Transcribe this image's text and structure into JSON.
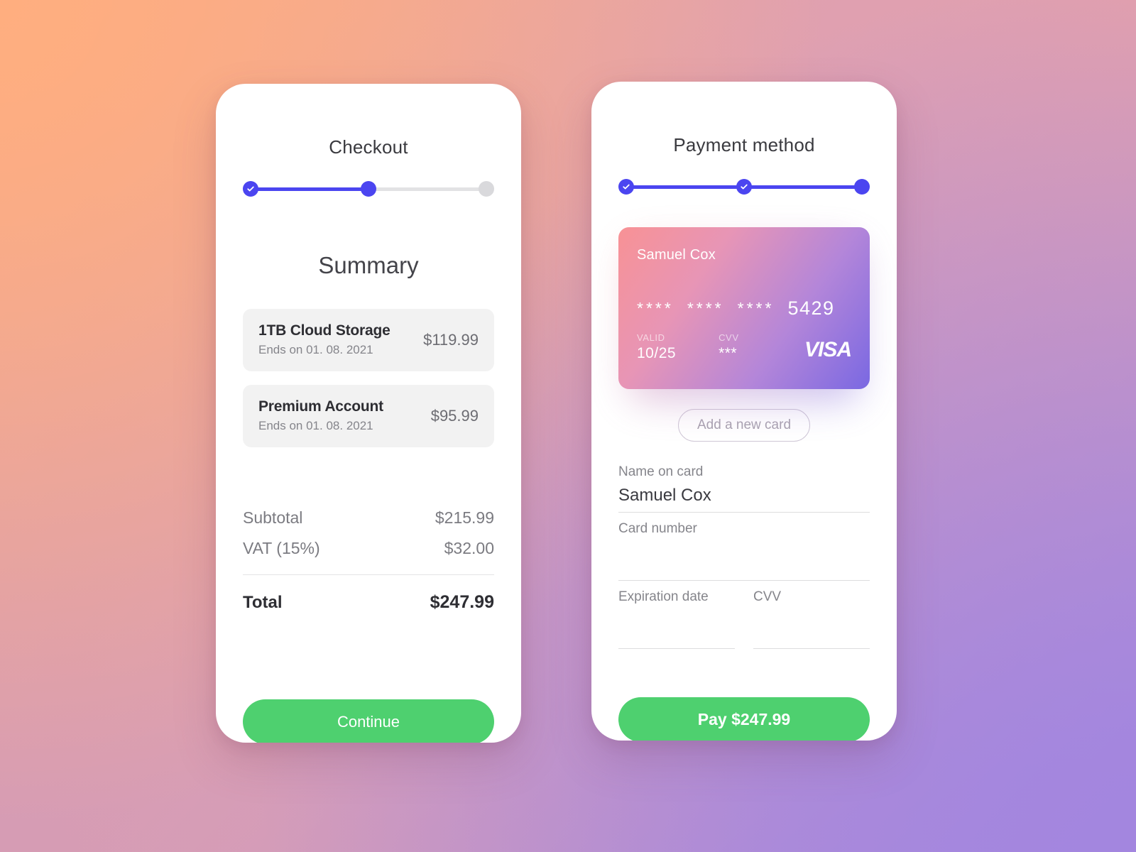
{
  "theme": {
    "accent_blue": "#4B45F0",
    "accent_green": "#4ED06F",
    "card_gradient_start": "#F89295",
    "card_gradient_end": "#7A68E2",
    "background_start": "#FFAE7F",
    "background_end": "#A386DF"
  },
  "checkout_screen": {
    "title": "Checkout",
    "stepper": {
      "steps": [
        {
          "state": "done",
          "icon": "check-icon"
        },
        {
          "state": "active",
          "icon": "dot"
        },
        {
          "state": "inactive",
          "icon": "dot"
        }
      ]
    },
    "summary_heading": "Summary",
    "items": [
      {
        "name": "1TB Cloud Storage",
        "subtitle": "Ends on 01. 08. 2021",
        "price": "$119.99"
      },
      {
        "name": "Premium Account",
        "subtitle": "Ends on 01. 08. 2021",
        "price": "$95.99"
      }
    ],
    "totals": [
      {
        "label": "Subtotal",
        "value": "$215.99"
      },
      {
        "label": "VAT (15%)",
        "value": "$32.00"
      }
    ],
    "total": {
      "label": "Total",
      "value": "$247.99"
    },
    "cta_label": "Continue"
  },
  "payment_screen": {
    "title": "Payment method",
    "stepper": {
      "steps": [
        {
          "state": "done",
          "icon": "check-icon"
        },
        {
          "state": "done",
          "icon": "check-icon"
        },
        {
          "state": "active",
          "icon": "dot"
        }
      ]
    },
    "credit_card": {
      "holder": "Samuel Cox",
      "number_groups": [
        "****",
        "****",
        "****"
      ],
      "number_last4": "5429",
      "valid_label": "VALID",
      "valid_value": "10/25",
      "cvv_label": "CVV",
      "cvv_value": "***",
      "brand": "VISA"
    },
    "add_card_label": "Add a new card",
    "form": {
      "name_on_card": {
        "label": "Name on card",
        "value": "Samuel Cox",
        "placeholder": ""
      },
      "card_number": {
        "label": "Card number",
        "value": "",
        "placeholder": ""
      },
      "expiration_date": {
        "label": "Expiration date",
        "value": "",
        "placeholder": ""
      },
      "cvv": {
        "label": "CVV",
        "value": "",
        "placeholder": ""
      }
    },
    "cta_label": "Pay $247.99"
  }
}
